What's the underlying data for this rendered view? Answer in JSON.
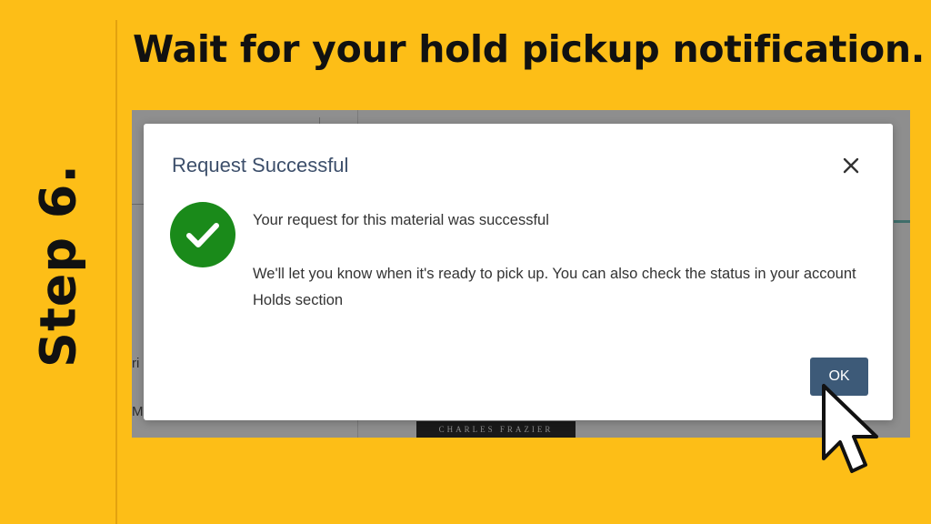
{
  "slide": {
    "step_label": "Step 6.",
    "headline": "Wait for your hold pickup notification."
  },
  "background_page": {
    "fragments": [
      "ri",
      "M"
    ],
    "book_cover_text": "CHARLES FRAZIER"
  },
  "dialog": {
    "title": "Request Successful",
    "close_icon": "close-icon",
    "status_icon": "check-circle-icon",
    "message_primary": "Your request for this material was successful",
    "message_secondary": "We'll let you know when it's ready to pick up. You can also check the status in your account Holds section",
    "ok_label": "OK"
  },
  "pointer": {
    "icon": "mouse-pointer-icon"
  },
  "colors": {
    "slide_background": "#FDBE17",
    "text_dark": "#111111",
    "dialog_title": "#3D4F6B",
    "success_green": "#1A8A1A",
    "ok_button": "#3D5A78",
    "overlay_gray": "#8E8E8E"
  }
}
